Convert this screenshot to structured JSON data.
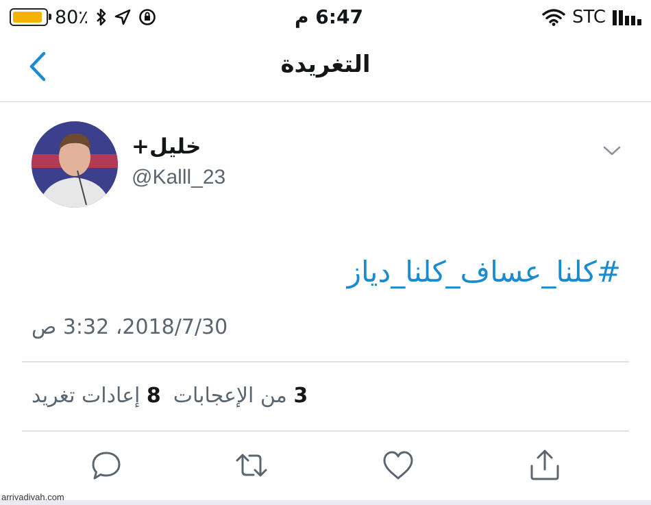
{
  "status_bar": {
    "battery": "80٪",
    "time": "6:47 م",
    "carrier": "STC",
    "battery_color": "#f5b301"
  },
  "nav": {
    "title": "التغريدة",
    "back_icon": "chevron-left-icon"
  },
  "tweet": {
    "display_name": "خليل+",
    "handle": "@Kalll_23",
    "text": "#كلنا_عساف_كلنا_دياز",
    "timestamp": "2018/7/30، 3:32 ص",
    "retweets": {
      "count": "3",
      "label": "من الإعجابات"
    },
    "likes": {
      "count": "8",
      "label": "إعادات تغريد"
    },
    "link_color": "#1b8bd1"
  },
  "actions": [
    {
      "icon": "reply-icon"
    },
    {
      "icon": "retweet-icon"
    },
    {
      "icon": "like-icon"
    },
    {
      "icon": "share-icon"
    }
  ],
  "watermark": "arriyadiyah.com"
}
